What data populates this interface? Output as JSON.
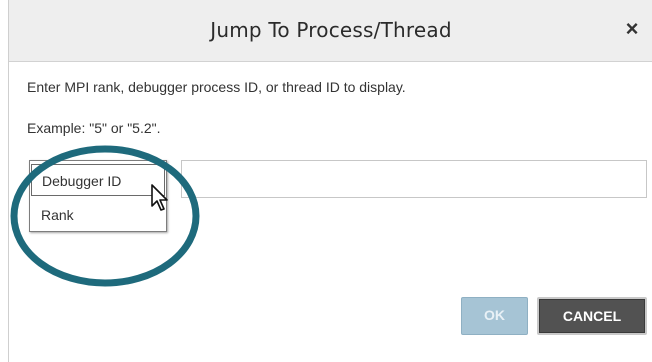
{
  "dialog": {
    "title": "Jump To Process/Thread",
    "close_symbol": "×",
    "instruction": "Enter MPI rank, debugger process ID, or thread ID to display.",
    "example": "Example: \"5\" or \"5.2\"."
  },
  "id_type_dropdown": {
    "options": [
      "Debugger ID",
      "Rank"
    ],
    "highlighted": "Debugger ID"
  },
  "id_input": {
    "value": ""
  },
  "buttons": {
    "ok_label": "OK",
    "cancel_label": "CANCEL"
  },
  "colors": {
    "ring": "#1e6a7c",
    "ok_button": "#a6c4d5",
    "cancel_button": "#525252",
    "titlebar": "#eeeeee"
  }
}
